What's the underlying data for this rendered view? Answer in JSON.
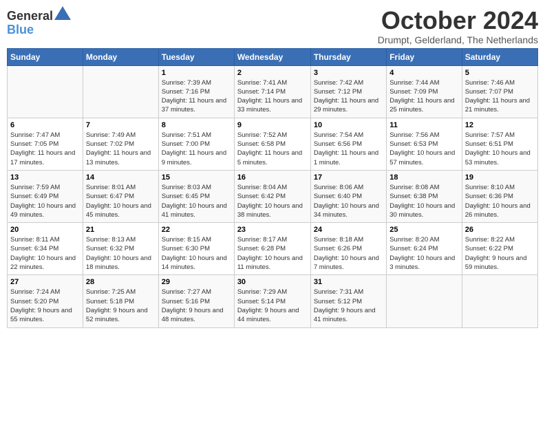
{
  "header": {
    "logo": {
      "line1": "General",
      "line2": "Blue"
    },
    "title": "October 2024",
    "location": "Drumpt, Gelderland, The Netherlands"
  },
  "weekdays": [
    "Sunday",
    "Monday",
    "Tuesday",
    "Wednesday",
    "Thursday",
    "Friday",
    "Saturday"
  ],
  "weeks": [
    [
      {
        "day": "",
        "sunrise": "",
        "sunset": "",
        "daylight": ""
      },
      {
        "day": "",
        "sunrise": "",
        "sunset": "",
        "daylight": ""
      },
      {
        "day": "1",
        "sunrise": "Sunrise: 7:39 AM",
        "sunset": "Sunset: 7:16 PM",
        "daylight": "Daylight: 11 hours and 37 minutes."
      },
      {
        "day": "2",
        "sunrise": "Sunrise: 7:41 AM",
        "sunset": "Sunset: 7:14 PM",
        "daylight": "Daylight: 11 hours and 33 minutes."
      },
      {
        "day": "3",
        "sunrise": "Sunrise: 7:42 AM",
        "sunset": "Sunset: 7:12 PM",
        "daylight": "Daylight: 11 hours and 29 minutes."
      },
      {
        "day": "4",
        "sunrise": "Sunrise: 7:44 AM",
        "sunset": "Sunset: 7:09 PM",
        "daylight": "Daylight: 11 hours and 25 minutes."
      },
      {
        "day": "5",
        "sunrise": "Sunrise: 7:46 AM",
        "sunset": "Sunset: 7:07 PM",
        "daylight": "Daylight: 11 hours and 21 minutes."
      }
    ],
    [
      {
        "day": "6",
        "sunrise": "Sunrise: 7:47 AM",
        "sunset": "Sunset: 7:05 PM",
        "daylight": "Daylight: 11 hours and 17 minutes."
      },
      {
        "day": "7",
        "sunrise": "Sunrise: 7:49 AM",
        "sunset": "Sunset: 7:02 PM",
        "daylight": "Daylight: 11 hours and 13 minutes."
      },
      {
        "day": "8",
        "sunrise": "Sunrise: 7:51 AM",
        "sunset": "Sunset: 7:00 PM",
        "daylight": "Daylight: 11 hours and 9 minutes."
      },
      {
        "day": "9",
        "sunrise": "Sunrise: 7:52 AM",
        "sunset": "Sunset: 6:58 PM",
        "daylight": "Daylight: 11 hours and 5 minutes."
      },
      {
        "day": "10",
        "sunrise": "Sunrise: 7:54 AM",
        "sunset": "Sunset: 6:56 PM",
        "daylight": "Daylight: 11 hours and 1 minute."
      },
      {
        "day": "11",
        "sunrise": "Sunrise: 7:56 AM",
        "sunset": "Sunset: 6:53 PM",
        "daylight": "Daylight: 10 hours and 57 minutes."
      },
      {
        "day": "12",
        "sunrise": "Sunrise: 7:57 AM",
        "sunset": "Sunset: 6:51 PM",
        "daylight": "Daylight: 10 hours and 53 minutes."
      }
    ],
    [
      {
        "day": "13",
        "sunrise": "Sunrise: 7:59 AM",
        "sunset": "Sunset: 6:49 PM",
        "daylight": "Daylight: 10 hours and 49 minutes."
      },
      {
        "day": "14",
        "sunrise": "Sunrise: 8:01 AM",
        "sunset": "Sunset: 6:47 PM",
        "daylight": "Daylight: 10 hours and 45 minutes."
      },
      {
        "day": "15",
        "sunrise": "Sunrise: 8:03 AM",
        "sunset": "Sunset: 6:45 PM",
        "daylight": "Daylight: 10 hours and 41 minutes."
      },
      {
        "day": "16",
        "sunrise": "Sunrise: 8:04 AM",
        "sunset": "Sunset: 6:42 PM",
        "daylight": "Daylight: 10 hours and 38 minutes."
      },
      {
        "day": "17",
        "sunrise": "Sunrise: 8:06 AM",
        "sunset": "Sunset: 6:40 PM",
        "daylight": "Daylight: 10 hours and 34 minutes."
      },
      {
        "day": "18",
        "sunrise": "Sunrise: 8:08 AM",
        "sunset": "Sunset: 6:38 PM",
        "daylight": "Daylight: 10 hours and 30 minutes."
      },
      {
        "day": "19",
        "sunrise": "Sunrise: 8:10 AM",
        "sunset": "Sunset: 6:36 PM",
        "daylight": "Daylight: 10 hours and 26 minutes."
      }
    ],
    [
      {
        "day": "20",
        "sunrise": "Sunrise: 8:11 AM",
        "sunset": "Sunset: 6:34 PM",
        "daylight": "Daylight: 10 hours and 22 minutes."
      },
      {
        "day": "21",
        "sunrise": "Sunrise: 8:13 AM",
        "sunset": "Sunset: 6:32 PM",
        "daylight": "Daylight: 10 hours and 18 minutes."
      },
      {
        "day": "22",
        "sunrise": "Sunrise: 8:15 AM",
        "sunset": "Sunset: 6:30 PM",
        "daylight": "Daylight: 10 hours and 14 minutes."
      },
      {
        "day": "23",
        "sunrise": "Sunrise: 8:17 AM",
        "sunset": "Sunset: 6:28 PM",
        "daylight": "Daylight: 10 hours and 11 minutes."
      },
      {
        "day": "24",
        "sunrise": "Sunrise: 8:18 AM",
        "sunset": "Sunset: 6:26 PM",
        "daylight": "Daylight: 10 hours and 7 minutes."
      },
      {
        "day": "25",
        "sunrise": "Sunrise: 8:20 AM",
        "sunset": "Sunset: 6:24 PM",
        "daylight": "Daylight: 10 hours and 3 minutes."
      },
      {
        "day": "26",
        "sunrise": "Sunrise: 8:22 AM",
        "sunset": "Sunset: 6:22 PM",
        "daylight": "Daylight: 9 hours and 59 minutes."
      }
    ],
    [
      {
        "day": "27",
        "sunrise": "Sunrise: 7:24 AM",
        "sunset": "Sunset: 5:20 PM",
        "daylight": "Daylight: 9 hours and 55 minutes."
      },
      {
        "day": "28",
        "sunrise": "Sunrise: 7:25 AM",
        "sunset": "Sunset: 5:18 PM",
        "daylight": "Daylight: 9 hours and 52 minutes."
      },
      {
        "day": "29",
        "sunrise": "Sunrise: 7:27 AM",
        "sunset": "Sunset: 5:16 PM",
        "daylight": "Daylight: 9 hours and 48 minutes."
      },
      {
        "day": "30",
        "sunrise": "Sunrise: 7:29 AM",
        "sunset": "Sunset: 5:14 PM",
        "daylight": "Daylight: 9 hours and 44 minutes."
      },
      {
        "day": "31",
        "sunrise": "Sunrise: 7:31 AM",
        "sunset": "Sunset: 5:12 PM",
        "daylight": "Daylight: 9 hours and 41 minutes."
      },
      {
        "day": "",
        "sunrise": "",
        "sunset": "",
        "daylight": ""
      },
      {
        "day": "",
        "sunrise": "",
        "sunset": "",
        "daylight": ""
      }
    ]
  ]
}
